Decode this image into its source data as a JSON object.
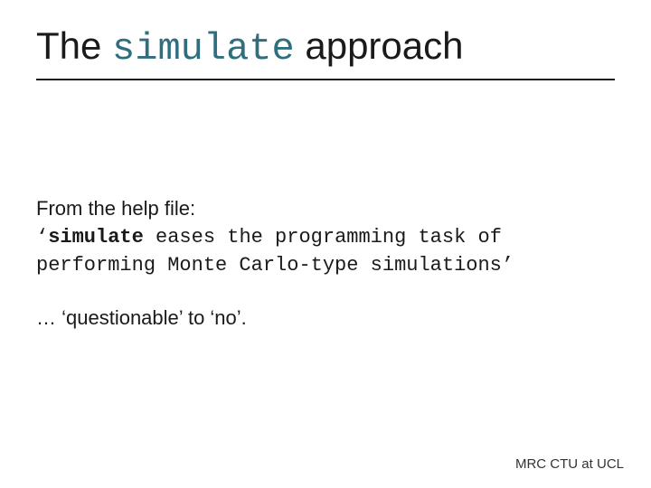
{
  "title": {
    "prefix": "The ",
    "code": "simulate",
    "suffix": " approach"
  },
  "body": {
    "line1": "From the help file:",
    "quote_open": "‘",
    "quote_bold": "simulate",
    "quote_rest": " eases the programming task of performing Monte Carlo-type simulations’",
    "line3": "… ‘questionable’ to ‘no’."
  },
  "footer": "MRC CTU at UCL"
}
